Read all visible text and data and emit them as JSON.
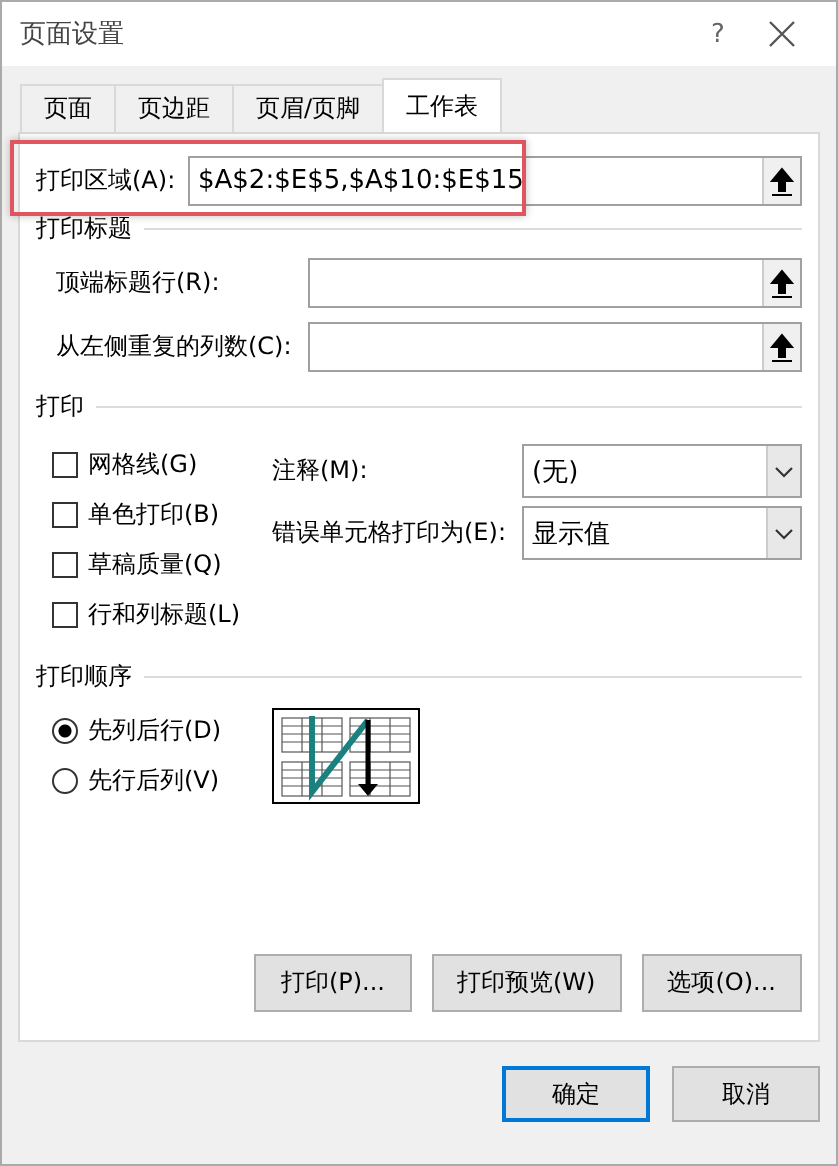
{
  "window": {
    "title": "页面设置",
    "help": "?"
  },
  "tabs": [
    {
      "label": "页面",
      "selected": false
    },
    {
      "label": "页边距",
      "selected": false
    },
    {
      "label": "页眉/页脚",
      "selected": false
    },
    {
      "label": "工作表",
      "selected": true
    }
  ],
  "print_area": {
    "label": "打印区域(A):",
    "value": "$A$2:$E$5,$A$10:$E$15"
  },
  "print_titles": {
    "heading": "打印标题",
    "fields": [
      {
        "label": "顶端标题行(R):"
      },
      {
        "label": "从左侧重复的列数(C):"
      }
    ]
  },
  "print": {
    "heading": "打印",
    "checkboxes": [
      {
        "label": "网格线(G)",
        "checked": false
      },
      {
        "label": "单色打印(B)",
        "checked": false
      },
      {
        "label": "草稿质量(Q)",
        "checked": false
      },
      {
        "label": "行和列标题(L)",
        "checked": false
      }
    ],
    "dropdowns": [
      {
        "label": "注释(M):",
        "value": "(无)"
      },
      {
        "label": "错误单元格打印为(E):",
        "value": "显示值"
      }
    ]
  },
  "print_order": {
    "heading": "打印顺序",
    "options": [
      {
        "label": "先列后行(D)",
        "selected": true
      },
      {
        "label": "先行后列(V)",
        "selected": false
      }
    ]
  },
  "panel_buttons": [
    "打印(P)...",
    "打印预览(W)",
    "选项(O)..."
  ],
  "footer_buttons": [
    {
      "label": "确定",
      "default": true
    },
    {
      "label": "取消",
      "default": false
    }
  ]
}
